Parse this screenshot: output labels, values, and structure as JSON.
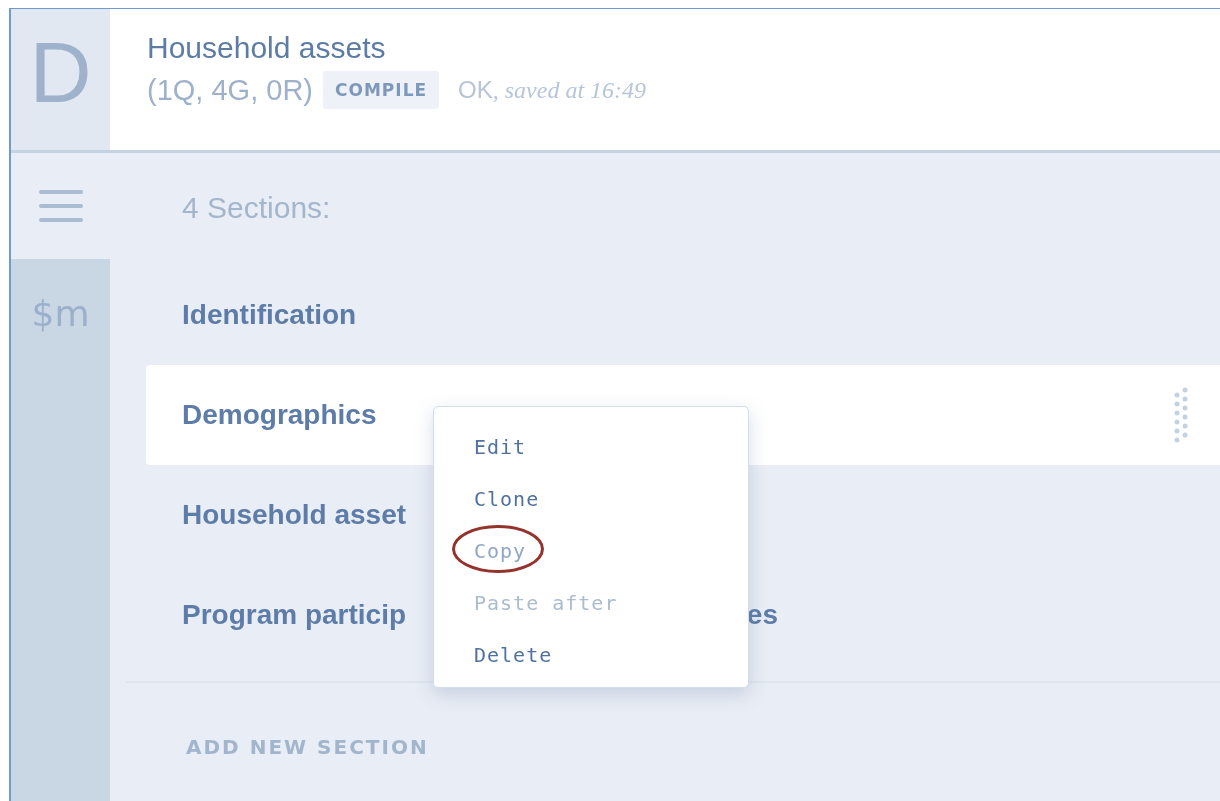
{
  "header": {
    "logo": "D",
    "title": "Household assets",
    "counts": "(1Q, 4G, 0R)",
    "compile_button": "COMPILE",
    "status": "OK",
    "saved": ", saved at 16:49"
  },
  "rail": {
    "variables_label": "$m"
  },
  "sections": {
    "heading": "4 Sections:",
    "items": [
      {
        "label": "Identification",
        "selected": false
      },
      {
        "label": "Demographics",
        "selected": true
      },
      {
        "label": "Household asset",
        "selected": false
      },
      {
        "label": "Program particip",
        "label_tail": "es",
        "selected": false
      }
    ],
    "add_button": "ADD NEW SECTION"
  },
  "context_menu": {
    "items": [
      {
        "label": "Edit",
        "disabled": false,
        "hovered": false,
        "circled": false
      },
      {
        "label": "Clone",
        "disabled": false,
        "hovered": false,
        "circled": false
      },
      {
        "label": "Copy",
        "disabled": false,
        "hovered": true,
        "circled": true
      },
      {
        "label": "Paste after",
        "disabled": true,
        "hovered": false,
        "circled": false
      },
      {
        "label": "Delete",
        "disabled": false,
        "hovered": false,
        "circled": false
      }
    ]
  }
}
